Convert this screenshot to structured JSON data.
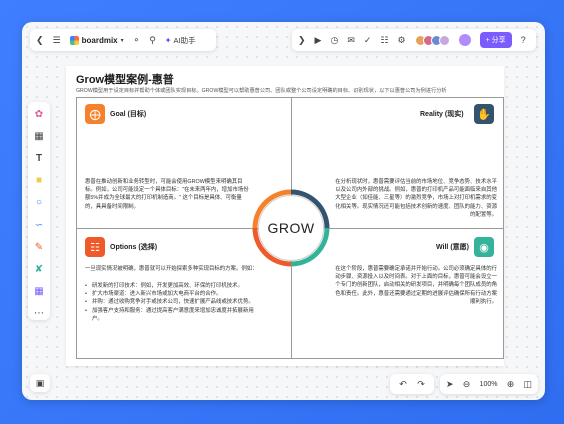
{
  "app": {
    "brand": "boardmix",
    "ai_label": "AI助手",
    "share_label": "分享",
    "zoom": "100%"
  },
  "document": {
    "title": "Grow模型案例-惠普",
    "subtitle": "GROW模型用于设定目标并帮助个体或团队实现目标。GROW模型可以帮助惠普公司、团队或整个公司设定明确的目标、识别现状，以下以惠普公司为例进行分析"
  },
  "center": {
    "label": "GROW"
  },
  "quadrants": {
    "goal": {
      "label": "Goal (目标)",
      "text": "惠普在推动创新和业务转型时，可能会使用GROW模型来明确其目标。例如，公司可能设定一个具体目标：\"在未来两年内，增加市场份额5%并成为全球最大的打印机制造商。\" 这个目标是具体、可衡量的，具具备时间限制。"
    },
    "reality": {
      "label": "Reality (现实)",
      "text": "在分析现状时，惠普需要评估当前的市场地位、竞争态势、技术水平以及公司内外部的挑战。例如，惠普的打印机产品可能面临来自其他大型企业（如佳能、三星等）的激烈竞争，市场上对打印机需求的变化相关等。现实情况还可能包括技术创新的速度、团队的能力、资源的配置等。"
    },
    "options": {
      "label": "Options (选择)",
      "intro": "一旦现实情况被明确，惠普就可以开始探索多种实现目标的方案。例如：",
      "bullets": [
        "研发新的打印技术：例如，开发更加高效、环保的打印机技术。",
        "扩大市场渠道：进入新兴市场或加大电商平台的合作。",
        "并购：通过收购竞争对手或技术公司，快速扩展产品线或技术优势。",
        "加强客户支持和服务：通过提高客户满意度来增加忠诚度并拓展新用户。"
      ]
    },
    "will": {
      "label": "Will (意愿)",
      "text": "在这个阶段，惠普需要确定承诺并开始行动。公司必须确定具体的行动步骤、资源投入以及时间表。对于上面的目标，惠普可能会设立一个专门的创新团队，启动相关的研发项目，并明确每个团队成员的角色和责任。此外，惠普还需要通过定期的进展评估确保所有行动方案顺利执行。"
    }
  },
  "colors": {
    "goal": "#f5822a",
    "reality": "#34536e",
    "options": "#ef5a2b",
    "will": "#35b39a",
    "share": "#7a5cff",
    "ai": "#5b4bff"
  },
  "icons": {
    "goal": "target-icon",
    "reality": "brain-hand-icon",
    "options": "options-icon",
    "will": "head-idea-icon"
  }
}
